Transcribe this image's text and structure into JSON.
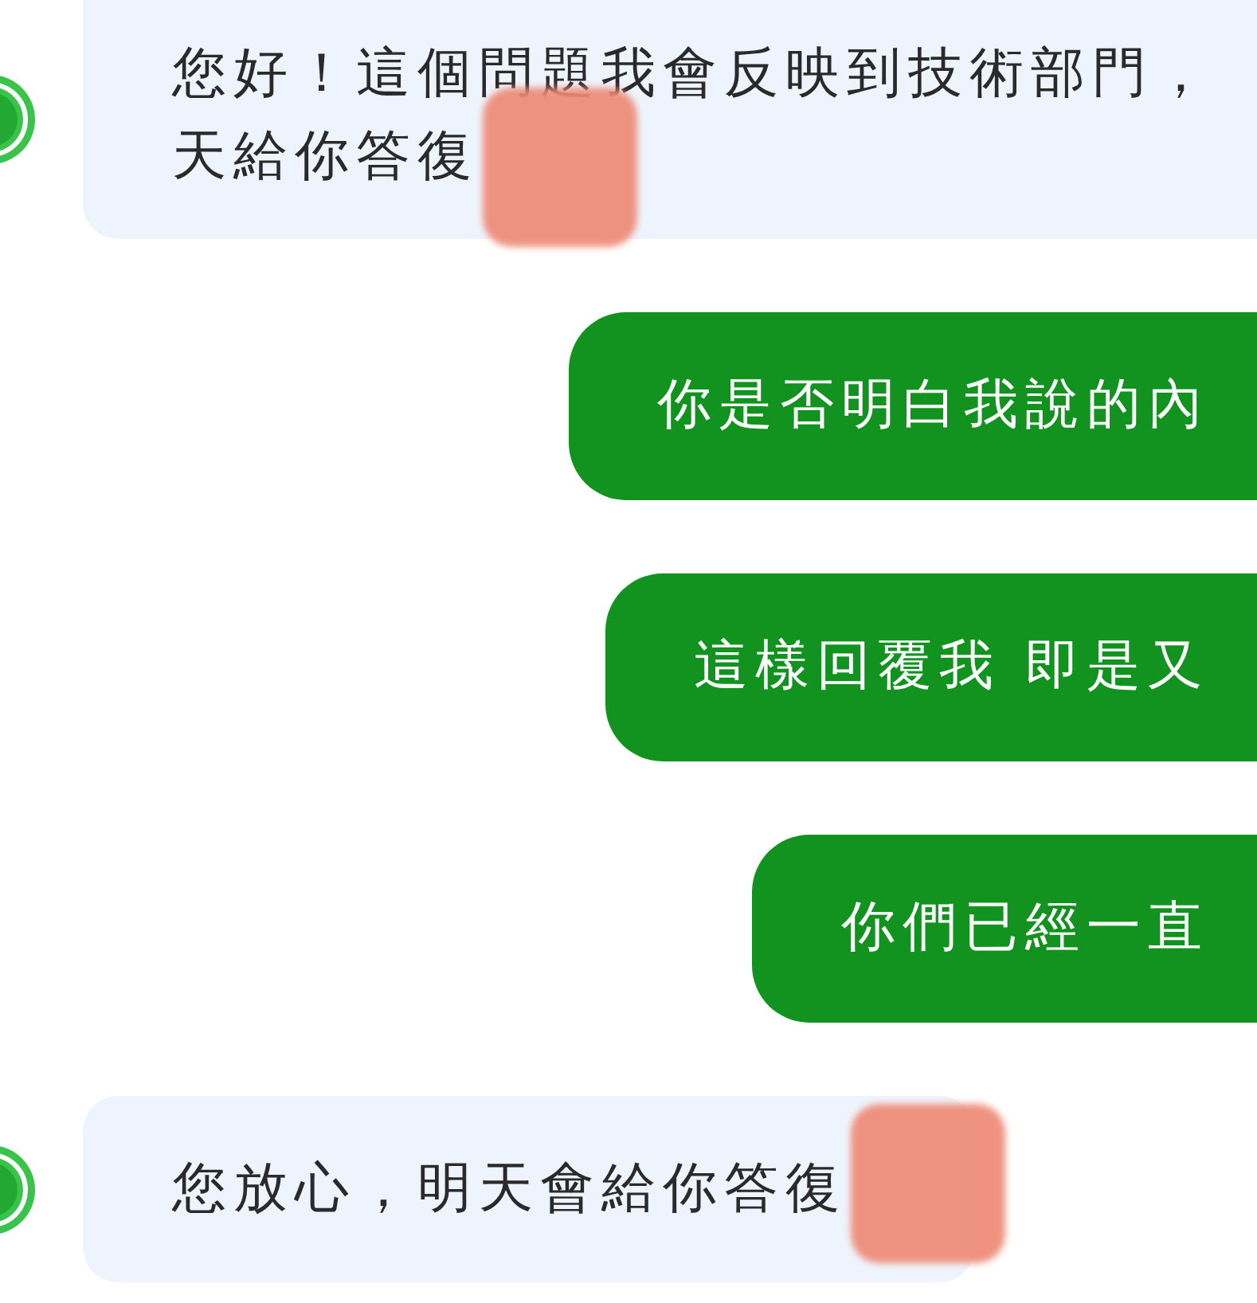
{
  "messages": [
    {
      "kind": "incoming",
      "lines": [
        "您好！這個問題我會反映到技術部門，",
        "天給你答復"
      ],
      "redacted": true
    },
    {
      "kind": "outgoing",
      "lines": [
        "你是否明白我說的內"
      ],
      "redacted": false
    },
    {
      "kind": "outgoing",
      "lines": [
        "這樣回覆我 即是又"
      ],
      "redacted": false
    },
    {
      "kind": "outgoing",
      "lines": [
        "你們已經一直"
      ],
      "redacted": false
    },
    {
      "kind": "incoming",
      "lines": [
        "您放心，明天會給你答復"
      ],
      "redacted": true
    }
  ]
}
